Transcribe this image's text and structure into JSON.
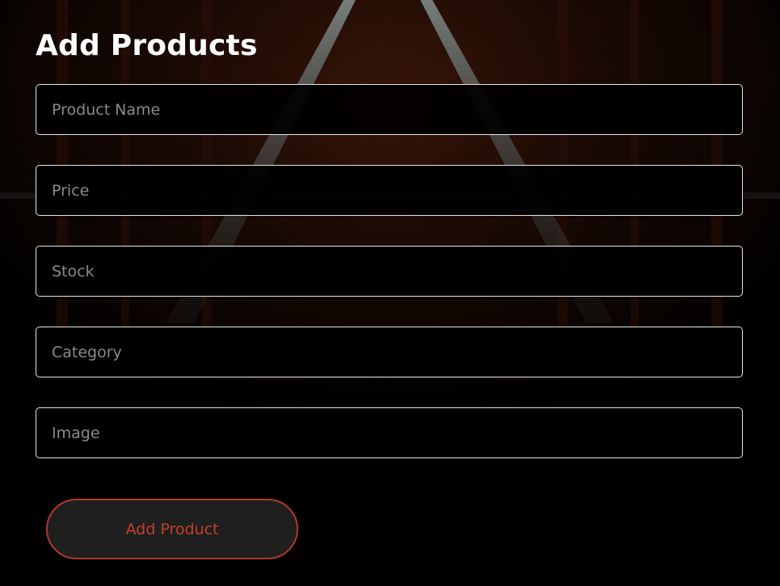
{
  "page": {
    "title": "Add Products"
  },
  "form": {
    "fields": [
      {
        "placeholder": "Product Name",
        "value": ""
      },
      {
        "placeholder": "Price",
        "value": ""
      },
      {
        "placeholder": "Stock",
        "value": ""
      },
      {
        "placeholder": "Category",
        "value": ""
      },
      {
        "placeholder": "Image",
        "value": ""
      }
    ],
    "submit_label": "Add Product"
  },
  "colors": {
    "background": "#000000",
    "field_border": "#e6e6e6",
    "accent": "#c0402c",
    "button_bg": "#1f1f1f"
  }
}
